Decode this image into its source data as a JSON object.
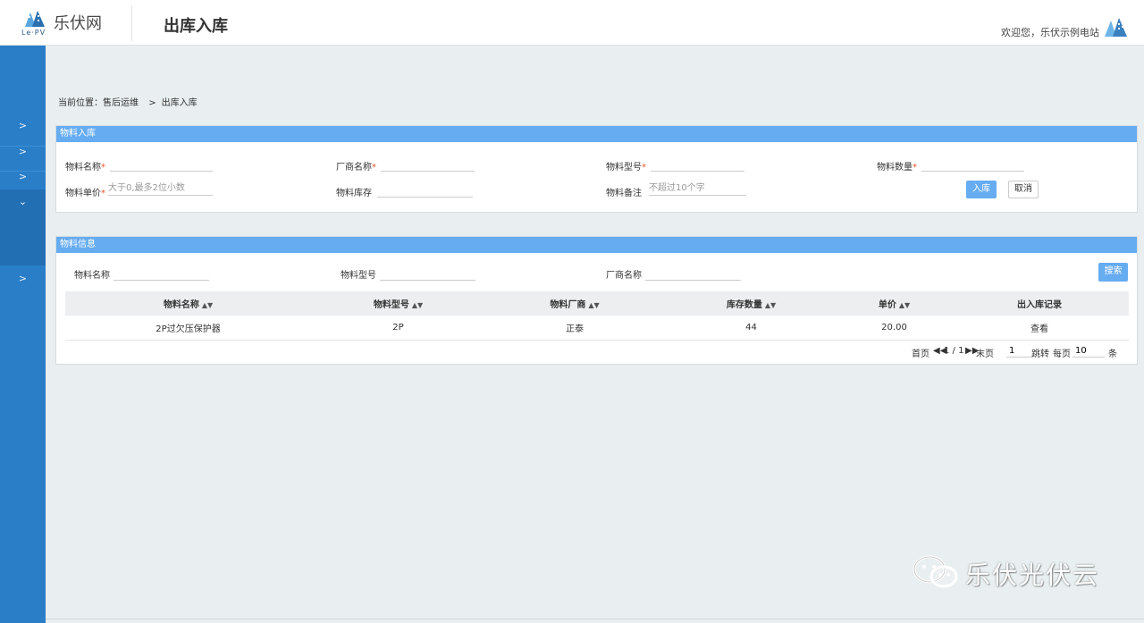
{
  "header": {
    "logo_text": "乐伏网",
    "logo_sub": "Le·PV",
    "page_title": "出库入库",
    "welcome": "欢迎您，乐伏示例电站"
  },
  "sidebar": {
    "items": [
      ">",
      ">",
      ">",
      "⌄",
      ">"
    ]
  },
  "breadcrumb": {
    "label": "当前位置：",
    "parent": "售后运维",
    "separator": ">",
    "current": "出库入库"
  },
  "stock_in": {
    "title": "物料入库",
    "material_name_label": "物料名称",
    "vendor_name_label": "厂商名称",
    "material_model_label": "物料型号",
    "material_qty_label": "物料数量",
    "unit_price_label": "物料单价",
    "unit_price_placeholder": "大于0,最多2位小数",
    "stock_label": "物料库存",
    "remark_label": "物料备注",
    "remark_placeholder": "不超过10个字",
    "required_mark": "*",
    "submit_label": "入库",
    "cancel_label": "取消"
  },
  "material_info": {
    "title": "物料信息",
    "filter_name_label": "物料名称",
    "filter_model_label": "物料型号",
    "filter_vendor_label": "厂商名称",
    "search_label": "搜索",
    "columns": [
      "物料名称",
      "物料型号",
      "物料厂商",
      "库存数量",
      "单价",
      "出入库记录"
    ],
    "rows": [
      {
        "name": "2P过欠压保护器",
        "model": "2P",
        "vendor": "正泰",
        "stock": "44",
        "price": "20.00",
        "record": "查看"
      }
    ],
    "pager": {
      "first": "首页",
      "page_info": "1 / 1",
      "last": "末页",
      "jump_value": "1",
      "jump_label": "跳转",
      "per_page_label": "每页",
      "per_page_value": "10",
      "unit": "条"
    }
  },
  "watermark": {
    "text": "乐伏光伏云"
  },
  "colors": {
    "sidebar": "#2a7ec8",
    "panel_header": "#66acf1",
    "page_bg": "#e9eef0",
    "required": "#e4572e"
  }
}
